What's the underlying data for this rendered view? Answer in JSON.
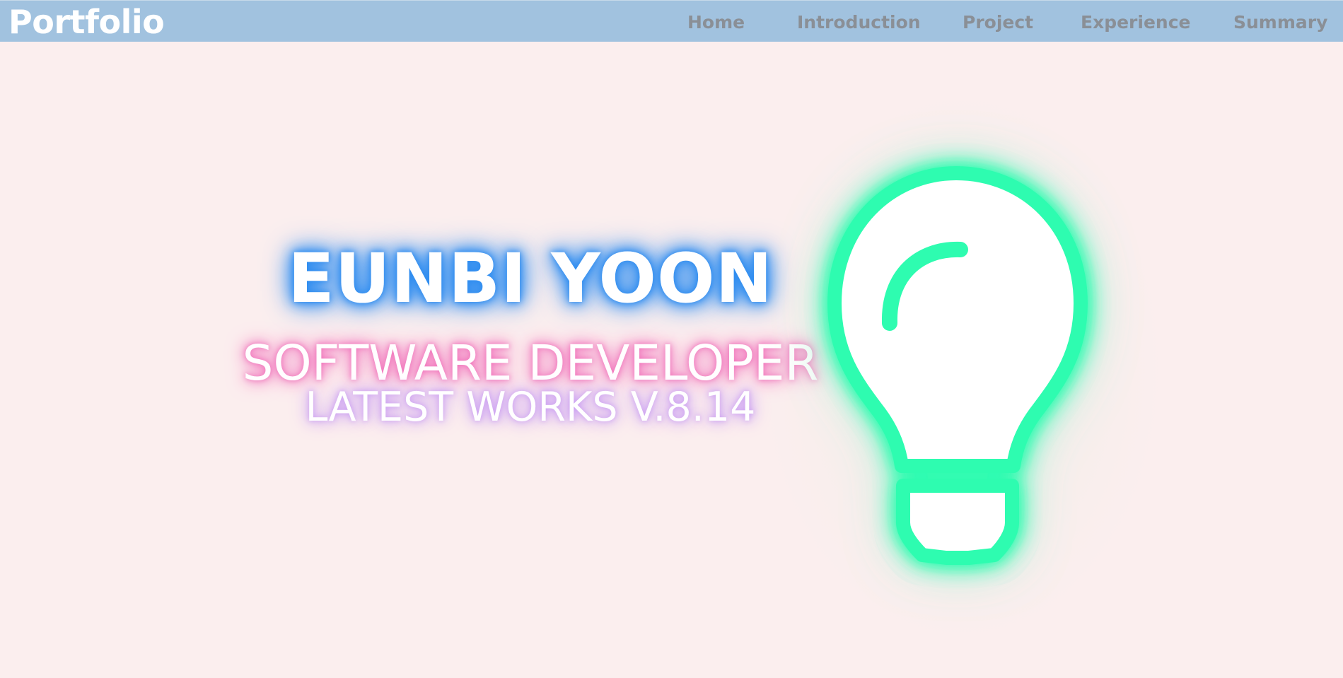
{
  "header": {
    "brand": "Portfolio",
    "nav": [
      {
        "label": "Home"
      },
      {
        "label": "Introduction"
      },
      {
        "label": "Project"
      },
      {
        "label": "Experience"
      },
      {
        "label": "Summary"
      }
    ]
  },
  "hero": {
    "name": "EUNBI YOON",
    "role": "SOFTWARE DEVELOPER",
    "version": "LATEST WORKS V.8.14",
    "icon": "lightbulb-icon"
  },
  "colors": {
    "navbar": "#a1c2df",
    "background": "#fbeeee",
    "name_glow": "#2d8cf0",
    "role_glow": "#f06cb8",
    "version_glow": "#c89bf2",
    "bulb_glow": "#2efcb0"
  }
}
